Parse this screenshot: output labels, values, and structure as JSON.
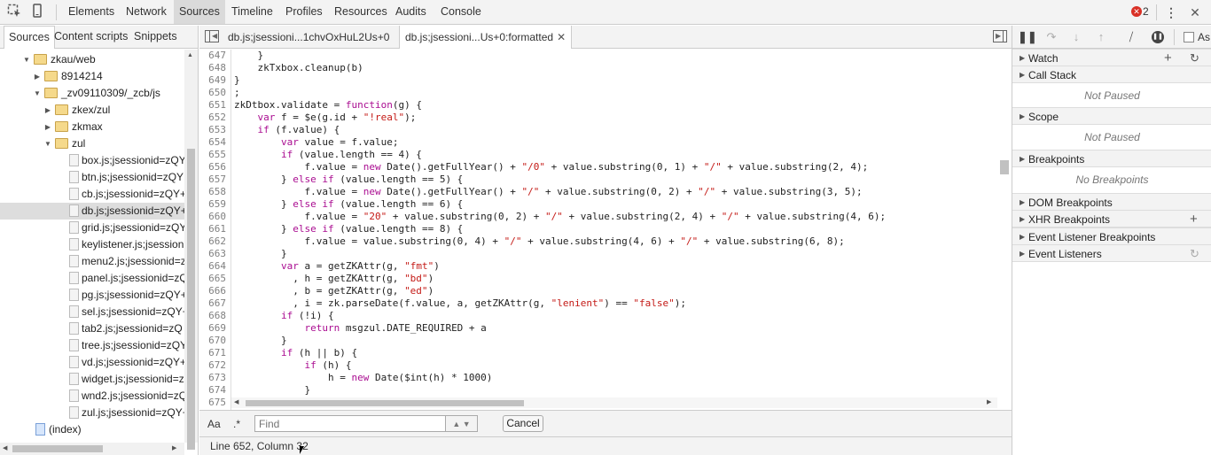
{
  "toolbar": {
    "inspect_icon": "inspect-element-icon",
    "device_icon": "device-mode-icon",
    "tabs": [
      "Elements",
      "Network",
      "Sources",
      "Timeline",
      "Profiles",
      "Resources",
      "Audits",
      "Console"
    ],
    "active_tab": "Sources",
    "error_badge_icon": "✕",
    "error_count": "2",
    "more_icon": "⋮",
    "close_icon": "✕"
  },
  "navigator": {
    "tabs": [
      "Sources",
      "Content scripts",
      "Snippets"
    ],
    "active_tab": "Sources",
    "tree": [
      {
        "label": "zkau/web",
        "type": "folder",
        "expanded": true
      },
      {
        "label": "8914214",
        "type": "folder",
        "expanded": false
      },
      {
        "label": "_zv09110309/_zcb/js",
        "type": "folder",
        "expanded": true
      },
      {
        "label": "zkex/zul",
        "type": "folder",
        "expanded": false
      },
      {
        "label": "zkmax",
        "type": "folder",
        "expanded": false
      },
      {
        "label": "zul",
        "type": "folder",
        "expanded": true
      },
      {
        "label": "box.js;jsessionid=zQY",
        "type": "file"
      },
      {
        "label": "btn.js;jsessionid=zQY",
        "type": "file"
      },
      {
        "label": "cb.js;jsessionid=zQY+",
        "type": "file"
      },
      {
        "label": "db.js;jsessionid=zQY+",
        "type": "file",
        "selected": true
      },
      {
        "label": "grid.js;jsessionid=zQY",
        "type": "file"
      },
      {
        "label": "keylistener.js;jsessioni",
        "type": "file"
      },
      {
        "label": "menu2.js;jsessionid=z",
        "type": "file"
      },
      {
        "label": "panel.js;jsessionid=zQ",
        "type": "file"
      },
      {
        "label": "pg.js;jsessionid=zQY+",
        "type": "file"
      },
      {
        "label": "sel.js;jsessionid=zQY+",
        "type": "file"
      },
      {
        "label": "tab2.js;jsessionid=zQ",
        "type": "file"
      },
      {
        "label": "tree.js;jsessionid=zQY",
        "type": "file"
      },
      {
        "label": "vd.js;jsessionid=zQY+",
        "type": "file"
      },
      {
        "label": "widget.js;jsessionid=z",
        "type": "file"
      },
      {
        "label": "wnd2.js;jsessionid=zQ",
        "type": "file"
      },
      {
        "label": "zul.js;jsessionid=zQY+",
        "type": "file"
      },
      {
        "label": "(index)",
        "type": "page"
      }
    ]
  },
  "editor": {
    "tabs": [
      {
        "label": "db.js;jsessioni...1chvOxHuL2Us+0",
        "active": false
      },
      {
        "label": "db.js;jsessioni...Us+0:formatted",
        "active": true
      }
    ],
    "lines": [
      {
        "n": "647",
        "t": "    }"
      },
      {
        "n": "648",
        "t": "    zkTxbox.cleanup(b)"
      },
      {
        "n": "649",
        "t": "}"
      },
      {
        "n": "650",
        "t": ";"
      },
      {
        "n": "651",
        "t": "zkDtbox.validate = function(g) {"
      },
      {
        "n": "652",
        "t": "    var f = $e(g.id + \"!real\");"
      },
      {
        "n": "653",
        "t": "    if (f.value) {"
      },
      {
        "n": "654",
        "t": "        var value = f.value;"
      },
      {
        "n": "655",
        "t": "        if (value.length == 4) {"
      },
      {
        "n": "656",
        "t": "            f.value = new Date().getFullYear() + \"/0\" + value.substring(0, 1) + \"/\" + value.substring(2, 4);"
      },
      {
        "n": "657",
        "t": "        } else if (value.length == 5) {"
      },
      {
        "n": "658",
        "t": "            f.value = new Date().getFullYear() + \"/\" + value.substring(0, 2) + \"/\" + value.substring(3, 5);"
      },
      {
        "n": "659",
        "t": "        } else if (value.length == 6) {"
      },
      {
        "n": "660",
        "t": "            f.value = \"20\" + value.substring(0, 2) + \"/\" + value.substring(2, 4) + \"/\" + value.substring(4, 6);"
      },
      {
        "n": "661",
        "t": "        } else if (value.length == 8) {"
      },
      {
        "n": "662",
        "t": "            f.value = value.substring(0, 4) + \"/\" + value.substring(4, 6) + \"/\" + value.substring(6, 8);"
      },
      {
        "n": "663",
        "t": "        }"
      },
      {
        "n": "664",
        "t": "        var a = getZKAttr(g, \"fmt\")"
      },
      {
        "n": "665",
        "t": "          , h = getZKAttr(g, \"bd\")"
      },
      {
        "n": "666",
        "t": "          , b = getZKAttr(g, \"ed\")"
      },
      {
        "n": "667",
        "t": "          , i = zk.parseDate(f.value, a, getZKAttr(g, \"lenient\") == \"false\");"
      },
      {
        "n": "668",
        "t": "        if (!i) {"
      },
      {
        "n": "669",
        "t": "            return msgzul.DATE_REQUIRED + a"
      },
      {
        "n": "670",
        "t": "        }"
      },
      {
        "n": "671",
        "t": "        if (h || b) {"
      },
      {
        "n": "672",
        "t": "            if (h) {"
      },
      {
        "n": "673",
        "t": "                h = new Date($int(h) * 1000)"
      },
      {
        "n": "674",
        "t": "            }"
      },
      {
        "n": "675",
        "t": ""
      }
    ],
    "find": {
      "case_label": "Aa",
      "regex_label": ".*",
      "placeholder": "Find",
      "cancel_label": "Cancel"
    },
    "status": "Line 652, Column 32"
  },
  "sidebar": {
    "async_label": "As",
    "panes": [
      {
        "title": "Watch",
        "info": ""
      },
      {
        "title": "Call Stack",
        "info": "Not Paused"
      },
      {
        "title": "Scope",
        "info": "Not Paused"
      },
      {
        "title": "Breakpoints",
        "info": "No Breakpoints"
      },
      {
        "title": "DOM Breakpoints",
        "info": ""
      },
      {
        "title": "XHR Breakpoints",
        "info": ""
      },
      {
        "title": "Event Listener Breakpoints",
        "info": ""
      },
      {
        "title": "Event Listeners",
        "info": ""
      }
    ]
  },
  "colors": {
    "keyword": "#aa0d91",
    "string": "#c41a16",
    "error": "#d93025",
    "selected_row": "#dddddd"
  }
}
